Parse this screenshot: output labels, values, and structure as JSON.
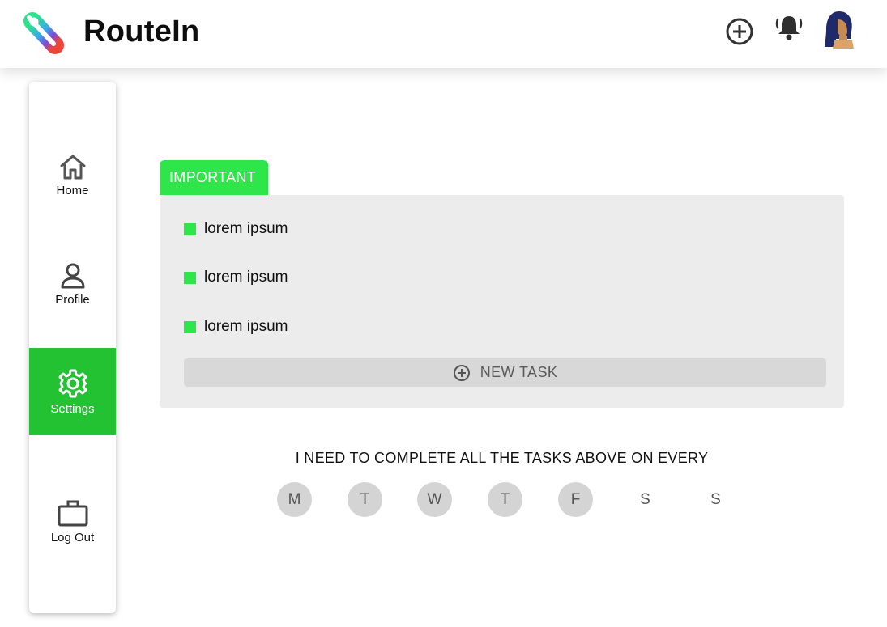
{
  "header": {
    "app_title": "RouteIn",
    "icons": [
      "logo",
      "add-circle-icon",
      "bell-icon",
      "avatar"
    ]
  },
  "sidebar": {
    "items": [
      {
        "label": "Home",
        "icon": "home-icon",
        "active": false
      },
      {
        "label": "Profile",
        "icon": "person-icon",
        "active": false
      },
      {
        "label": "Settings",
        "icon": "gear-icon",
        "active": true
      },
      {
        "label": "Log Out",
        "icon": "briefcase-icon",
        "active": false
      }
    ],
    "active_color": "#22c232"
  },
  "important": {
    "tab_label": "IMPORTANT",
    "tasks": [
      "lorem ipsum",
      "lorem ipsum",
      "lorem ipsum"
    ],
    "new_task_label": "NEW TASK",
    "accent": "#2ee64a"
  },
  "recurrence": {
    "text": "I NEED TO COMPLETE ALL THE TASKS ABOVE ON EVERY",
    "days": [
      {
        "label": "M",
        "selected": true
      },
      {
        "label": "T",
        "selected": true
      },
      {
        "label": "W",
        "selected": true
      },
      {
        "label": "T",
        "selected": true
      },
      {
        "label": "F",
        "selected": true
      },
      {
        "label": "S",
        "selected": false
      },
      {
        "label": "S",
        "selected": false
      }
    ]
  }
}
